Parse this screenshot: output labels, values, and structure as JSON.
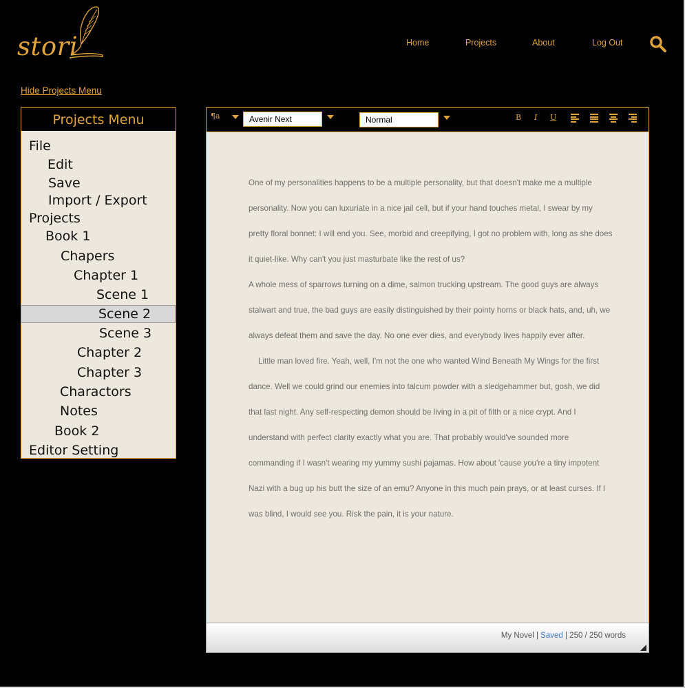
{
  "brand": {
    "logo_text": "stori"
  },
  "nav": {
    "home": "Home",
    "projects": "Projects",
    "about": "About",
    "logout": "Log Out"
  },
  "sidebar": {
    "toggle_label": "Hide Projects Menu",
    "title": "Projects Menu",
    "items": [
      {
        "label": "File"
      },
      {
        "label": "Edit"
      },
      {
        "label": "Save"
      },
      {
        "label": "Import / Export"
      },
      {
        "label": "Projects"
      },
      {
        "label": "Book 1"
      },
      {
        "label": "Chapers"
      },
      {
        "label": "Chapter 1"
      },
      {
        "label": "Scene 1"
      },
      {
        "label": "Scene 2",
        "selected": true
      },
      {
        "label": "Scene 3"
      },
      {
        "label": "Chapter 2"
      },
      {
        "label": "Chapter 3"
      },
      {
        "label": "Charactors"
      },
      {
        "label": "Notes"
      },
      {
        "label": "Book 2"
      },
      {
        "label": "Editor Setting"
      }
    ]
  },
  "toolbar": {
    "paragraph_label": "¶a",
    "font_family": "Avenir Next",
    "style": "Normal",
    "bold": "B",
    "italic": "I",
    "underline": "U"
  },
  "document": {
    "paragraphs": [
      "One of my personalities happens to be a multiple personality, but that doesn't make me a multiple personality. Now you can luxuriate in a nice jail cell, but if your hand touches metal, I swear by my pretty floral bonnet: I will end you. See, morbid and creepifying, I got no problem with, long as she does it quiet-like. Why can't you just masturbate like the rest of us?",
      "A whole mess of sparrows turning on a dime, salmon trucking upstream. The good guys are always stalwart and true, the bad guys are easily distinguished by their pointy horns or black hats, and, uh, we always defeat them and save the day. No one ever dies, and everybody lives happily ever after.",
      "Little man loved fire. Yeah, well, I'm not the one who wanted Wind Beneath My Wings for the first dance. Well we could grind our enemies into talcum powder with a sledgehammer but, gosh, we did that last night. Any self-respecting demon should be living in a pit of filth or a nice crypt. And I understand with perfect clarity exactly what you are. That probably would've sounded more commanding if I wasn't wearing my yummy sushi pajamas. How about 'cause you're a tiny impotent Nazi with a bug up his butt the size of an emu? Anyone in this much pain prays, or at least curses. If I was blind, I would see you. Risk the pain, it is your nature."
    ]
  },
  "status": {
    "project": "My Novel |",
    "saved": "Saved",
    "word_count": "| 250 / 250 words"
  },
  "colors": {
    "accent": "#e0a33a",
    "background": "#000000",
    "paper": "#ece8dd",
    "saved": "#3d78c8"
  },
  "icons": [
    "quill-logo-icon",
    "search-icon",
    "caret-down-icon",
    "align-left-icon",
    "align-justify-icon",
    "align-center-icon",
    "align-right-icon",
    "resize-grip-icon"
  ]
}
